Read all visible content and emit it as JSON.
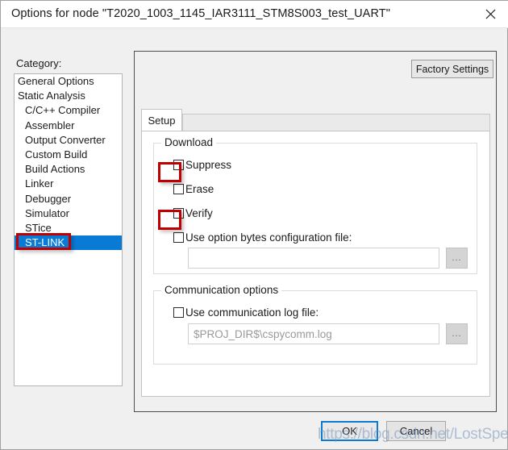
{
  "window": {
    "title": "Options for node \"T2020_1003_1145_IAR3111_STM8S003_test_UART\"",
    "close_icon": "close-icon"
  },
  "category": {
    "label": "Category:",
    "items": [
      {
        "label": "General Options",
        "indent": false,
        "selected": false
      },
      {
        "label": "Static Analysis",
        "indent": false,
        "selected": false
      },
      {
        "label": "C/C++ Compiler",
        "indent": true,
        "selected": false
      },
      {
        "label": "Assembler",
        "indent": true,
        "selected": false
      },
      {
        "label": "Output Converter",
        "indent": true,
        "selected": false
      },
      {
        "label": "Custom Build",
        "indent": true,
        "selected": false
      },
      {
        "label": "Build Actions",
        "indent": true,
        "selected": false
      },
      {
        "label": "Linker",
        "indent": true,
        "selected": false
      },
      {
        "label": "Debugger",
        "indent": true,
        "selected": false
      },
      {
        "label": "Simulator",
        "indent": true,
        "selected": false
      },
      {
        "label": "STice",
        "indent": true,
        "selected": false
      },
      {
        "label": "ST-LINK",
        "indent": true,
        "selected": true
      }
    ]
  },
  "content": {
    "factory_settings_label": "Factory Settings",
    "tabs": [
      {
        "label": "Setup",
        "active": true
      }
    ],
    "download": {
      "group_title": "Download",
      "suppress": {
        "label": "Suppress",
        "checked": false,
        "annotated": true
      },
      "erase": {
        "label": "Erase",
        "checked": false,
        "annotated": false
      },
      "verify": {
        "label": "Verify",
        "checked": false,
        "annotated": true
      },
      "option_bytes": {
        "label": "Use option bytes configuration file:",
        "checked": false
      },
      "option_bytes_path": "",
      "option_bytes_browse_label": "..."
    },
    "communication": {
      "group_title": "Communication options",
      "use_log_file": {
        "label": "Use communication log file:",
        "checked": false
      },
      "log_file_path": "$PROJ_DIR$\\cspycomm.log",
      "log_file_browse_label": "..."
    }
  },
  "footer": {
    "ok_label": "OK",
    "cancel_label": "Cancel"
  },
  "watermark": {
    "text": "https://blog.csdn.net/LostSpeed"
  },
  "colors": {
    "selection": "#0a7bd4",
    "annotation": "#c00000",
    "dialog_background": "#f0f0f0",
    "panel_background": "#ffffff"
  }
}
